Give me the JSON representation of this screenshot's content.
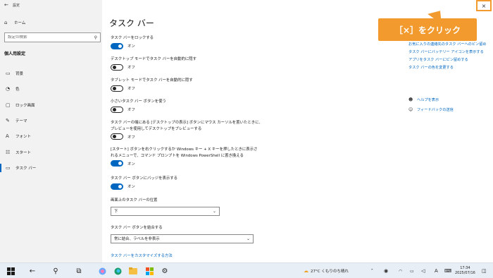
{
  "window": {
    "title": "設定"
  },
  "sidebar": {
    "home_label": "ホーム",
    "search_placeholder": "設定の検索",
    "section_title": "個人用設定",
    "items": [
      {
        "label": "背景",
        "icon": "picture-icon"
      },
      {
        "label": "色",
        "icon": "palette-icon"
      },
      {
        "label": "ロック画面",
        "icon": "lock-screen-icon"
      },
      {
        "label": "テーマ",
        "icon": "brush-icon"
      },
      {
        "label": "フォント",
        "icon": "font-icon"
      },
      {
        "label": "スタート",
        "icon": "start-icon"
      },
      {
        "label": "タスク バー",
        "icon": "taskbar-icon",
        "active": true
      }
    ]
  },
  "main": {
    "title": "タスク バー",
    "settings": [
      {
        "label": "タスク バーをロックする",
        "state": "オン",
        "on": true
      },
      {
        "label": "デスクトップ モードでタスク バーを自動的に隠す",
        "state": "オフ",
        "on": false
      },
      {
        "label": "タブレット モードでタスク バーを自動的に隠す",
        "state": "オフ",
        "on": false
      },
      {
        "label": "小さいタスク バー ボタンを使う",
        "state": "オフ",
        "on": false
      },
      {
        "label_line1": "タスク バーの端にある [デスクトップの表示] ボタンにマウス カーソルを置いたときに、",
        "label_line2": "プレビューを使用してデスクトップをプレビューする",
        "state": "オフ",
        "on": false
      },
      {
        "label_line1": "[スタート] ボタンを右クリックするか Windows キー + X キーを押したときに表示さ",
        "label_line2": "れるメニューで、コマンド プロンプトを Windows PowerShell に置き換える",
        "state": "オン",
        "on": true
      },
      {
        "label": "タスク バー ボタンにバッジを表示する",
        "state": "オン",
        "on": true
      }
    ],
    "position": {
      "label": "画面上のタスク バーの位置",
      "value": "下"
    },
    "combine": {
      "label": "タスク バー ボタンを結合する",
      "value": "常に結合、ラベルを非表示"
    },
    "customize_link": "タスク バーをカスタマイズする方法"
  },
  "related": {
    "links": [
      "お気に入りの連絡先のタスク バーへのピン留め",
      "タスク バーにバッテリー アイコンを表示する",
      "アプリをタスク バーにピン留めする",
      "タスク バーの色を変更する"
    ],
    "help": "ヘルプを表示",
    "feedback": "フィードバックの送信"
  },
  "callout": {
    "text": "［×］をクリック"
  },
  "close_button": {
    "glyph": "×"
  },
  "taskbar": {
    "weather": "27°C くもりのち晴れ",
    "ime": "A",
    "time": "17:34",
    "date": "2025/07/16"
  },
  "colors": {
    "accent": "#0067c0",
    "callout": "#f29a2e"
  }
}
